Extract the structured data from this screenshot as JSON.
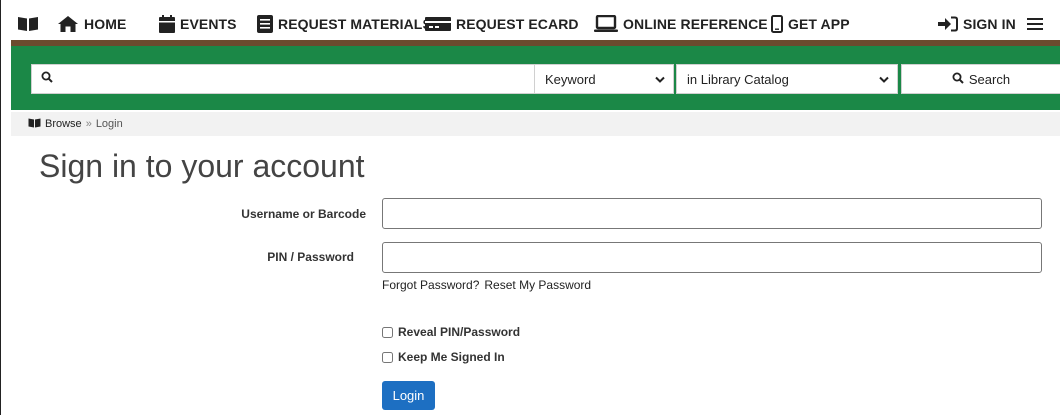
{
  "nav": {
    "items": [
      {
        "label": "",
        "icon": "book-icon"
      },
      {
        "label": "HOME",
        "icon": "home-icon"
      },
      {
        "label": "EVENTS",
        "icon": "calendar-icon"
      },
      {
        "label": "REQUEST MATERIALS",
        "icon": "document-icon"
      },
      {
        "label": "REQUEST ECARD",
        "icon": "card-icon"
      },
      {
        "label": "ONLINE REFERENCE",
        "icon": "laptop-icon"
      },
      {
        "label": "GET APP",
        "icon": "phone-icon"
      }
    ],
    "sign_in_label": "SIGN IN",
    "sign_in_icon": "sign-in-icon",
    "menu_icon": "hamburger-menu-icon"
  },
  "search": {
    "input_value": "",
    "input_placeholder": "",
    "search_type_selected": "Keyword",
    "scope_selected": "in Library Catalog",
    "button_label": "Search"
  },
  "breadcrumb": {
    "browse_label": "Browse",
    "separator": "»",
    "current": "Login"
  },
  "login": {
    "title": "Sign in to your account",
    "username_label": "Username or Barcode",
    "username_value": "",
    "password_label": "PIN / Password",
    "password_value": "",
    "forgot_text": "Forgot Password?",
    "reset_link": "Reset My Password",
    "reveal_label": "Reveal PIN/Password",
    "keep_signed_label": "Keep Me Signed In",
    "login_button": "Login"
  },
  "colors": {
    "brand_green": "#1b8847",
    "accent_brown": "#6b4b2e",
    "primary_button": "#1d6fc2"
  }
}
